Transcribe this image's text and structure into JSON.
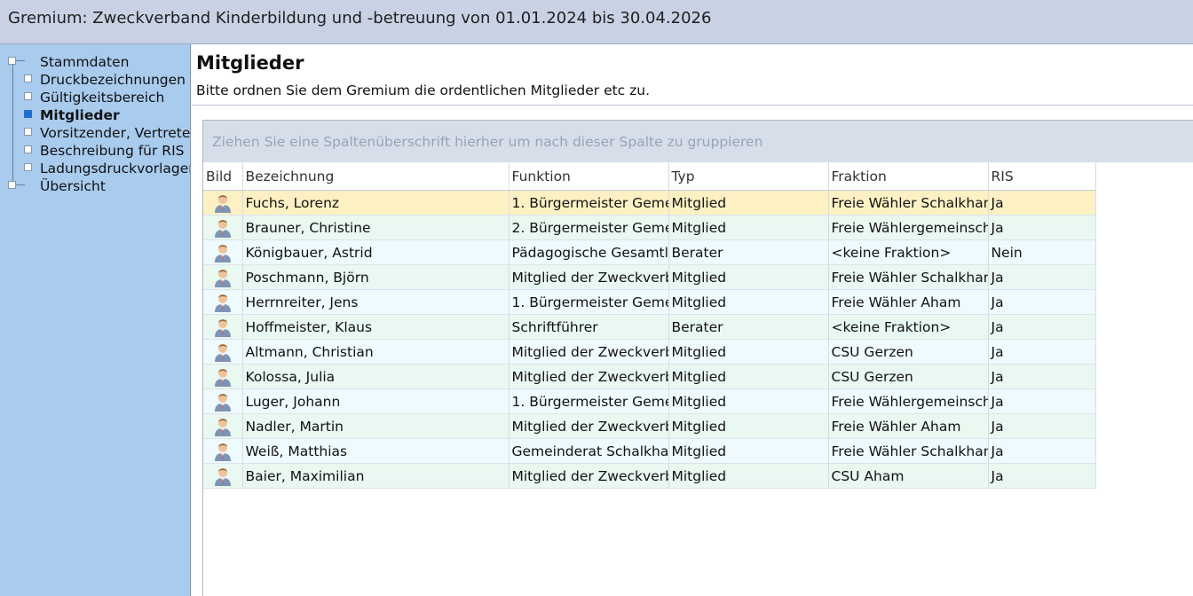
{
  "window": {
    "title": "Gremium: Zweckverband Kinderbildung und -betreuung von 01.01.2024 bis 30.04.2026"
  },
  "sidebar": {
    "items": [
      {
        "label": "Stammdaten"
      },
      {
        "label": "Druckbezeichnungen"
      },
      {
        "label": "Gültigkeitsbereich"
      },
      {
        "label": "Mitglieder"
      },
      {
        "label": "Vorsitzender, Vertreter"
      },
      {
        "label": "Beschreibung für RIS"
      },
      {
        "label": "Ladungsdruckvorlagen"
      },
      {
        "label": "Übersicht"
      }
    ],
    "selected_index": 3
  },
  "main": {
    "title": "Mitglieder",
    "subtitle": "Bitte ordnen Sie dem Gremium die ordentlichen Mitglieder etc zu.",
    "group_panel_hint": "Ziehen Sie eine Spaltenüberschrift hierher um nach dieser Spalte zu gruppieren"
  },
  "table": {
    "columns": [
      "Bild",
      "Bezeichnung",
      "Funktion",
      "Typ",
      "Fraktion",
      "RIS"
    ],
    "selected_row": 0,
    "rows": [
      {
        "bezeichnung": "Fuchs, Lorenz",
        "funktion": "1. Bürgermeister Geme",
        "typ": "Mitglied",
        "fraktion": "Freie Wähler Schalkhan",
        "ris": "Ja"
      },
      {
        "bezeichnung": "Brauner, Christine",
        "funktion": "2. Bürgermeister Geme",
        "typ": "Mitglied",
        "fraktion": "Freie Wählergemeinsch",
        "ris": "Ja"
      },
      {
        "bezeichnung": "Königbauer, Astrid",
        "funktion": "Pädagogische Gesamtle",
        "typ": "Berater",
        "fraktion": "<keine Fraktion>",
        "ris": "Nein"
      },
      {
        "bezeichnung": "Poschmann, Björn",
        "funktion": "Mitglied der Zweckverb",
        "typ": "Mitglied",
        "fraktion": "Freie Wähler Schalkhan",
        "ris": "Ja"
      },
      {
        "bezeichnung": "Herrnreiter, Jens",
        "funktion": "1. Bürgermeister Geme",
        "typ": "Mitglied",
        "fraktion": "Freie Wähler Aham",
        "ris": "Ja"
      },
      {
        "bezeichnung": "Hoffmeister, Klaus",
        "funktion": "Schriftführer",
        "typ": "Berater",
        "fraktion": "<keine Fraktion>",
        "ris": "Ja"
      },
      {
        "bezeichnung": "Altmann, Christian",
        "funktion": "Mitglied der Zweckverb",
        "typ": "Mitglied",
        "fraktion": "CSU Gerzen",
        "ris": "Ja"
      },
      {
        "bezeichnung": "Kolossa, Julia",
        "funktion": "Mitglied der Zweckverb",
        "typ": "Mitglied",
        "fraktion": "CSU Gerzen",
        "ris": "Ja"
      },
      {
        "bezeichnung": "Luger, Johann",
        "funktion": "1. Bürgermeister Geme",
        "typ": "Mitglied",
        "fraktion": "Freie Wählergemeinsch",
        "ris": "Ja"
      },
      {
        "bezeichnung": "Nadler, Martin",
        "funktion": "Mitglied der Zweckverb",
        "typ": "Mitglied",
        "fraktion": "Freie Wähler Aham",
        "ris": "Ja"
      },
      {
        "bezeichnung": "Weiß, Matthias",
        "funktion": "Gemeinderat Schalkhar",
        "typ": "Mitglied",
        "fraktion": "Freie Wähler Schalkhan",
        "ris": "Ja"
      },
      {
        "bezeichnung": "Baier, Maximilian",
        "funktion": "Mitglied der Zweckverb",
        "typ": "Mitglied",
        "fraktion": "CSU Aham",
        "ris": "Ja"
      }
    ]
  },
  "icons": {
    "row_picture": "person-icon",
    "tree_node": "tree-node-icon"
  },
  "colors": {
    "selection": "#1f6fd1",
    "selected_row": "#fdf1c4",
    "sidebar_bg": "#a8cbee"
  }
}
